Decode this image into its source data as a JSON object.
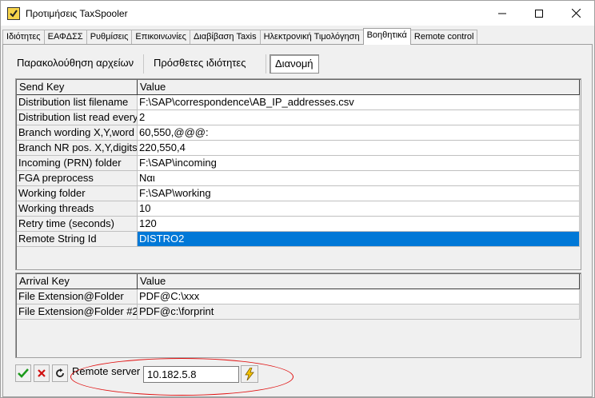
{
  "window": {
    "title": "Προτιμήσεις TaxSpooler"
  },
  "tabs": [
    "Ιδιότητες",
    "ΕΑΦΔΣΣ",
    "Ρυθμίσεις",
    "Επικοινωνίες",
    "Διαβίβαση Taxis",
    "Ηλεκτρονική Τιμολόγηση",
    "Βοηθητικά",
    "Remote control"
  ],
  "subtabs": [
    "Παρακολούθηση αρχείων",
    "Πρόσθετες ιδιότητες",
    "Διανομή"
  ],
  "send_grid": {
    "headers": [
      "Send Key",
      "Value"
    ],
    "rows": [
      {
        "key": "Distribution list filename",
        "value": "F:\\SAP\\correspondence\\AB_IP_addresses.csv"
      },
      {
        "key": "Distribution list read every",
        "value": "2"
      },
      {
        "key": "Branch wording X,Y,word",
        "value": "60,550,@@@:"
      },
      {
        "key": "Branch NR pos. X,Y,digits",
        "value": "220,550,4"
      },
      {
        "key": "Incoming (PRN) folder",
        "value": "F:\\SAP\\incoming"
      },
      {
        "key": "FGA preprocess",
        "value": "Ναι"
      },
      {
        "key": "Working folder",
        "value": "F:\\SAP\\working"
      },
      {
        "key": "Working threads",
        "value": "10"
      },
      {
        "key": "Retry time (seconds)",
        "value": "120"
      },
      {
        "key": "Remote String Id",
        "value": "DISTRO2"
      }
    ]
  },
  "arrival_grid": {
    "headers": [
      "Arrival Key",
      "Value"
    ],
    "rows": [
      {
        "key": "File Extension@Folder",
        "value": "PDF@C:\\xxx"
      },
      {
        "key": "File Extension@Folder #2",
        "value": "PDF@c:\\forprint"
      }
    ]
  },
  "remote": {
    "label": "Remote server",
    "value": "10.182.5.8"
  },
  "colors": {
    "selection": "#0078d7",
    "annotation": "#e01010"
  }
}
